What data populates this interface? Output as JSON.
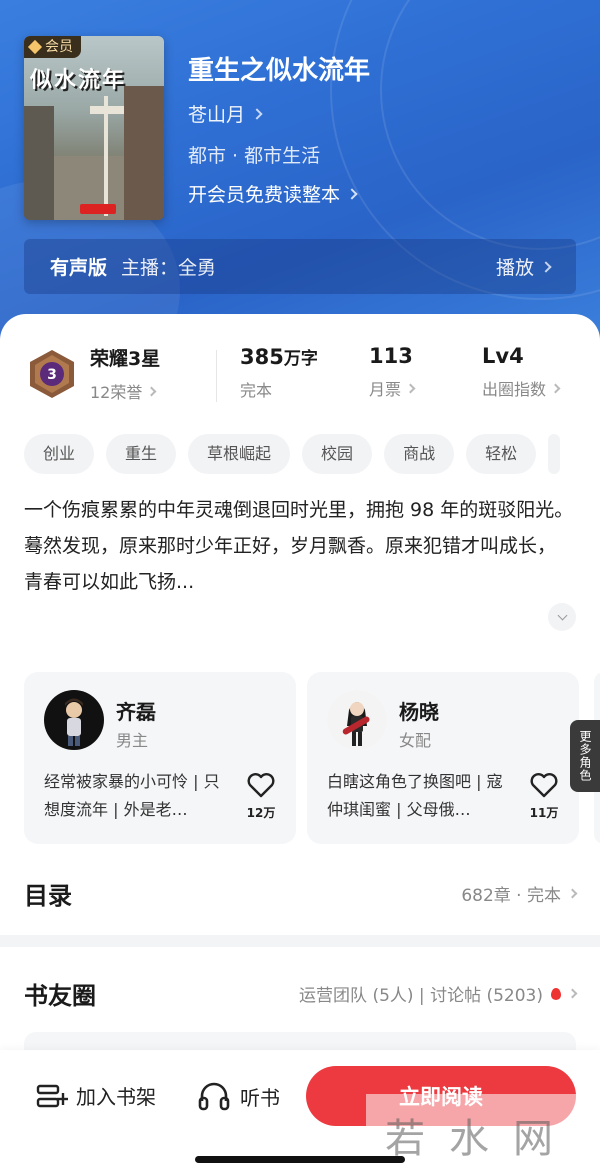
{
  "book": {
    "vip_badge": "会员",
    "cover_title": "似水流年",
    "title": "重生之似水流年",
    "author": "苍山月",
    "genre": "都市 · 都市生活",
    "vip_read": "开会员免费读整本"
  },
  "audio": {
    "label": "有声版",
    "host": "主播：全勇",
    "play": "播放"
  },
  "stats": {
    "honor_title": "荣耀3星",
    "honor_sub": "12荣誉",
    "words_num": "385",
    "words_unit": "万字",
    "words_sub": "完本",
    "tickets": "113",
    "tickets_sub": "月票",
    "level": "Lv4",
    "level_sub": "出圈指数",
    "medal_number": "3"
  },
  "tags": [
    "创业",
    "重生",
    "草根崛起",
    "校园",
    "商战",
    "轻松"
  ],
  "description": {
    "line1": "一个伤痕累累的中年灵魂倒退回时光里，拥抱 98 年的斑驳阳光。",
    "line2": "蓦然发现，原来那时少年正好，岁月飘香。原来犯错才叫成长，青春可以如此飞扬..."
  },
  "characters": [
    {
      "name": "齐磊",
      "role": "男主",
      "desc": "经常被家暴的小可怜 | 只想度流年 | 外是老…",
      "likes": "12万"
    },
    {
      "name": "杨晓",
      "role": "女配",
      "desc": "白瞎这角色了换图吧 | 寇仲琪闺蜜 | 父母俄…",
      "likes": "11万"
    }
  ],
  "more_roles": "更多角色",
  "catalog": {
    "title": "目录",
    "info": "682章 · 完本"
  },
  "circle": {
    "title": "书友圈",
    "info": "运营团队 (5人) | 讨论帖 (5203)"
  },
  "bottom_bar": {
    "shelf": "加入书架",
    "listen": "听书",
    "read": "立即阅读"
  },
  "watermark": "若水网",
  "colors": {
    "accent": "#ec3a40",
    "hero_blue": "#2f6fd4",
    "tag_bg": "#f2f3f5"
  }
}
